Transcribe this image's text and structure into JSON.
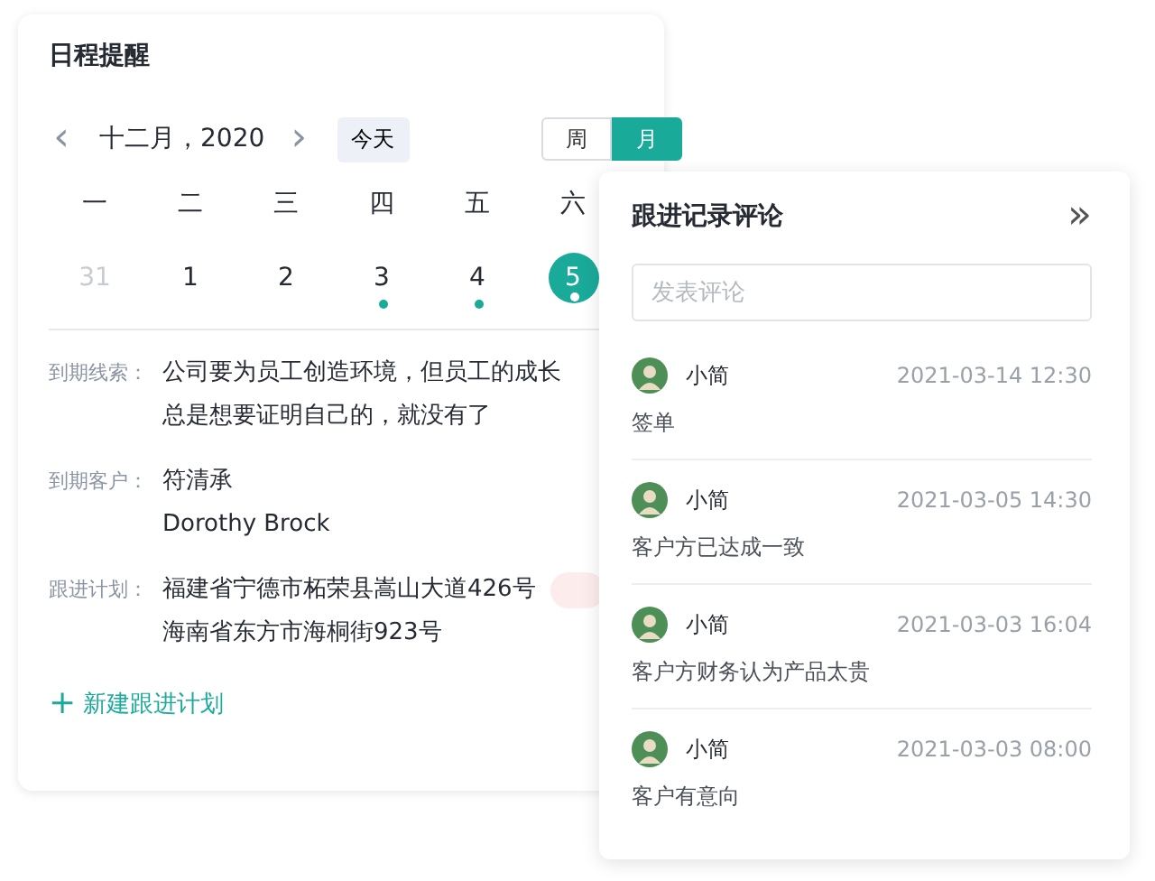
{
  "schedule": {
    "title": "日程提醒",
    "prev": "‹",
    "month": "十二月，2020",
    "next": "›",
    "today": "今天",
    "views": [
      {
        "label": "周",
        "selected": false
      },
      {
        "label": "月",
        "selected": true
      }
    ],
    "weekdays": [
      "一",
      "二",
      "三",
      "四",
      "五",
      "六"
    ],
    "days": [
      {
        "label": "31",
        "other_month": true,
        "has_event": false,
        "selected": false
      },
      {
        "label": "1",
        "other_month": false,
        "has_event": false,
        "selected": false
      },
      {
        "label": "2",
        "other_month": false,
        "has_event": false,
        "selected": false
      },
      {
        "label": "3",
        "other_month": false,
        "has_event": true,
        "selected": false
      },
      {
        "label": "4",
        "other_month": false,
        "has_event": true,
        "selected": false
      },
      {
        "label": "5",
        "other_month": false,
        "has_event": true,
        "selected": true
      }
    ],
    "details": [
      {
        "label": "到期线索：",
        "lines": [
          "公司要为员工创造环境，但员工的成长",
          "总是想要证明自己的，就没有了"
        ]
      },
      {
        "label": "到期客户：",
        "lines": [
          "符清承",
          "Dorothy Brock"
        ]
      },
      {
        "label": "跟进计划：",
        "lines": [
          "福建省宁德市柘荣县嵩山大道426号",
          "海南省东方市海桐街923号"
        ],
        "tag": true
      }
    ],
    "add_button": {
      "icon": "+",
      "label": "新建跟进计划"
    }
  },
  "comments": {
    "title": "跟进记录评论",
    "collapse": "»",
    "input": {
      "placeholder": "发表评论"
    },
    "items": [
      {
        "author": "小简",
        "time": "2021-03-14 12:30",
        "text": "签单"
      },
      {
        "author": "小简",
        "time": "2021-03-05 14:30",
        "text": "客户方已达成一致"
      },
      {
        "author": "小简",
        "time": "2021-03-03 16:04",
        "text": "客户方财务认为产品太贵"
      },
      {
        "author": "小简",
        "time": "2021-03-03 08:00",
        "text": "客户有意向"
      }
    ]
  }
}
